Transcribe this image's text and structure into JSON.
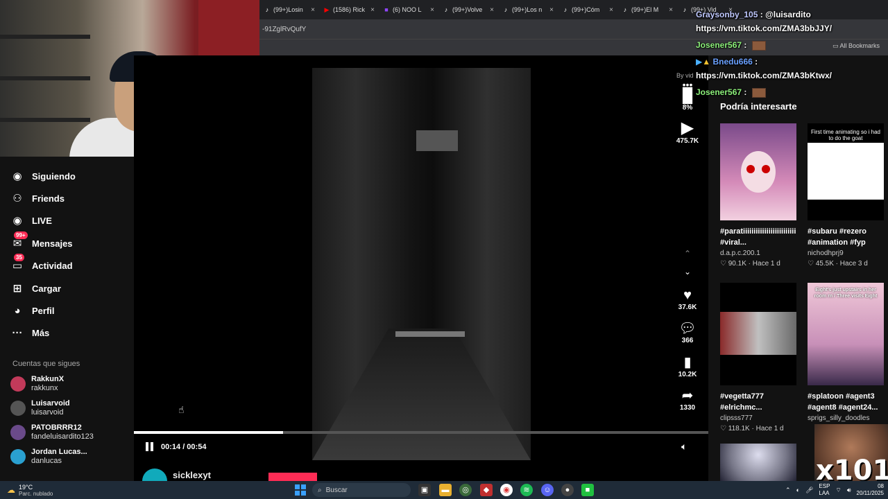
{
  "browser": {
    "tabs": [
      {
        "icon": "tiktok-icon",
        "glyph": "♪",
        "label": "(99+)Losin",
        "color": "#fff"
      },
      {
        "icon": "youtube-icon",
        "glyph": "▶",
        "label": "(1586) Rick",
        "color": "#f00"
      },
      {
        "icon": "twitch-icon",
        "glyph": "■",
        "label": "(6) NOO L",
        "color": "#9146ff"
      },
      {
        "icon": "tiktok-icon",
        "glyph": "♪",
        "label": "(99+)Volve",
        "color": "#fff"
      },
      {
        "icon": "tiktok-icon",
        "glyph": "♪",
        "label": "(99+)Los n",
        "color": "#fff"
      },
      {
        "icon": "tiktok-icon",
        "glyph": "♪",
        "label": "(99+)Cóm",
        "color": "#fff"
      },
      {
        "icon": "tiktok-icon",
        "glyph": "♪",
        "label": "(99+)El M",
        "color": "#fff"
      },
      {
        "icon": "tiktok-icon",
        "glyph": "♪",
        "label": "(99+) Vid",
        "color": "#fff"
      }
    ],
    "address": "-91ZglRvQufY",
    "all_bookmarks": "All Bookmarks"
  },
  "nav": {
    "items": [
      {
        "name": "siguiendo",
        "label": "Siguiendo",
        "icon": "users-icon",
        "glyph": "◉",
        "badge": ""
      },
      {
        "name": "friends",
        "label": "Friends",
        "icon": "friends-icon",
        "glyph": "⚇",
        "badge": ""
      },
      {
        "name": "live",
        "label": "LIVE",
        "icon": "live-icon",
        "glyph": "◉",
        "badge": ""
      },
      {
        "name": "mensajes",
        "label": "Mensajes",
        "icon": "messages-icon",
        "glyph": "✉",
        "badge": "99+"
      },
      {
        "name": "actividad",
        "label": "Actividad",
        "icon": "activity-icon",
        "glyph": "▭",
        "badge": "35"
      },
      {
        "name": "cargar",
        "label": "Cargar",
        "icon": "upload-icon",
        "glyph": "⊞",
        "badge": ""
      },
      {
        "name": "perfil",
        "label": "Perfil",
        "icon": "profile-icon",
        "glyph": "◕",
        "badge": ""
      },
      {
        "name": "mas",
        "label": "Más",
        "icon": "more-icon",
        "glyph": "···",
        "badge": ""
      }
    ],
    "following_title": "Cuentas que sigues",
    "following": [
      {
        "name": "RakkunX",
        "handle": "rakkunx",
        "color": "#c23a5a"
      },
      {
        "name": "Luisarvoid",
        "handle": "luisarvoid",
        "color": "#555"
      },
      {
        "name": "PATOBRRR12",
        "handle": "fandeluisardito123",
        "color": "#6a4a8a"
      },
      {
        "name": "Jordan Lucas...",
        "handle": "danlucas",
        "color": "#2aa0d0"
      }
    ]
  },
  "video": {
    "by_label": "By vid",
    "time": "00:14 / 00:54",
    "progress": 0.26
  },
  "rail": {
    "stats_pct": "8%",
    "plays": "475.7K",
    "likes": "37.6K",
    "comments": "366",
    "saves": "10.2K",
    "shares": "1330"
  },
  "author": {
    "name": "sicklexyt"
  },
  "reco": {
    "title": "Podría interesarte",
    "cards": [
      {
        "title": "#paratiiiiiiiiiiiiiiiiiiiiiiiii #viral...",
        "user": "d.a.p.c.200.1",
        "likes": "90.1K",
        "age": "Hace 1 d",
        "thumb_text": ""
      },
      {
        "title": "#subaru #rezero #animation #fyp",
        "user": "nichodhprj9",
        "likes": "45.5K",
        "age": "Hace 3 d",
        "thumb_text": "First time animating so i had to do the goat"
      },
      {
        "title": "#vegetta777 #elrichmc...",
        "user": "clipsss777",
        "likes": "118.1K",
        "age": "Hace 1 d",
        "thumb_text": ""
      },
      {
        "title": "#splatoon #agent3 #agent8 #agent24...",
        "user": "sprigs_silly_doodles",
        "likes": "",
        "age": "",
        "thumb_text": "Eight's just upstairs in her room rn / Three visits Eight"
      }
    ]
  },
  "chat": [
    {
      "user": "Graysonby_105",
      "text": "@luisardito",
      "style": "gray",
      "badges": false,
      "emote": false
    },
    {
      "user": "",
      "text": "https://vm.tiktok.com/ZMA3bbJJY/",
      "style": "",
      "badges": false,
      "emote": false
    },
    {
      "user": "Josener567",
      "text": "",
      "style": "",
      "badges": false,
      "emote": true
    },
    {
      "user": "Bnedu666",
      "text": "",
      "style": "blue",
      "badges": true,
      "emote": false
    },
    {
      "user": "",
      "text": "https://vm.tiktok.com/ZMA3bKtwx/",
      "style": "",
      "badges": false,
      "emote": false
    },
    {
      "user": "Josener567",
      "text": "",
      "style": "",
      "badges": false,
      "emote": true
    }
  ],
  "overlay": {
    "multiplier": "x101"
  },
  "taskbar": {
    "temp": "19°C",
    "weather": "Parc. nublado",
    "search": "Buscar",
    "lang": "ESP",
    "lang2": "LAA",
    "time": "08",
    "date": "20/11/2025"
  }
}
